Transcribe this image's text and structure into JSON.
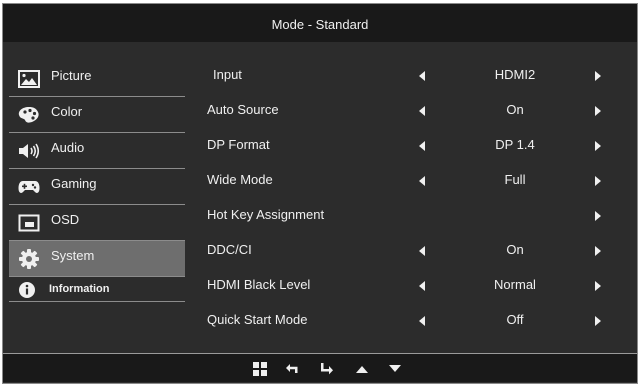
{
  "header": {
    "title": "Mode - Standard"
  },
  "sidebar": {
    "items": [
      {
        "label": "Picture",
        "icon": "picture-icon"
      },
      {
        "label": "Color",
        "icon": "palette-icon"
      },
      {
        "label": "Audio",
        "icon": "speaker-icon"
      },
      {
        "label": "Gaming",
        "icon": "gamepad-icon"
      },
      {
        "label": "OSD",
        "icon": "osd-window-icon"
      },
      {
        "label": "System",
        "icon": "gear-icon",
        "active": true
      },
      {
        "label": "Information",
        "icon": "info-icon"
      }
    ]
  },
  "settings": [
    {
      "label": "Input",
      "value": "HDMI2"
    },
    {
      "label": "Auto Source",
      "value": "On"
    },
    {
      "label": "DP Format",
      "value": "DP 1.4"
    },
    {
      "label": "Wide Mode",
      "value": "Full"
    },
    {
      "label": "Hot Key Assignment",
      "value": ""
    },
    {
      "label": "DDC/CI",
      "value": "On"
    },
    {
      "label": "HDMI Black Level",
      "value": "Normal"
    },
    {
      "label": "Quick Start Mode",
      "value": "Off"
    }
  ],
  "footer": {
    "buttons": [
      "menu-grid-icon",
      "back-icon",
      "enter-icon",
      "up-arrow-icon",
      "down-arrow-icon"
    ]
  },
  "colors": {
    "panel": "#2c2c2c",
    "bar": "#191919",
    "active": "#6e6e6e",
    "text": "#f0f0f0"
  }
}
